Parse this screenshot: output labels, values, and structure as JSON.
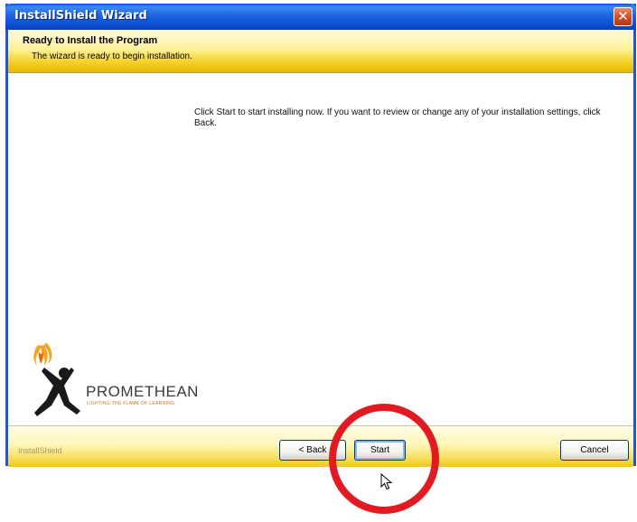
{
  "window": {
    "title": "InstallShield Wizard",
    "close_glyph": "✕"
  },
  "header": {
    "title": "Ready to Install the Program",
    "subtitle": "The wizard is ready to begin installation."
  },
  "body": {
    "message": "Click Start to start installing now. If you want to review or change any of your installation settings, click Back."
  },
  "logo": {
    "name": "PROMETHEAN",
    "tagline": "LIGHTING THE FLAME OF LEARNING"
  },
  "footer": {
    "brand": "InstallShield",
    "back_label": "< Back",
    "start_label": "Start",
    "cancel_label": "Cancel"
  },
  "colors": {
    "titlebar": "#0a56d8",
    "header_yellow": "#f5d22c",
    "annotation_circle": "#e11b22"
  },
  "icons": [
    "close-icon",
    "promethean-logo-icon",
    "cursor-icon"
  ]
}
